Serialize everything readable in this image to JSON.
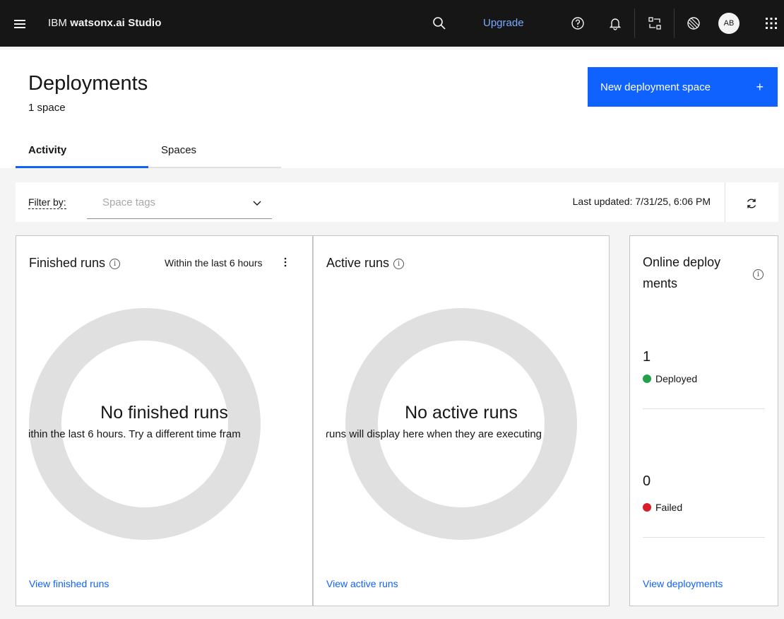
{
  "header": {
    "brand_prefix": "IBM",
    "brand_product": "watsonx.ai Studio",
    "upgrade_label": "Upgrade",
    "avatar_initials": "AB"
  },
  "page": {
    "title": "Deployments",
    "subtitle": "1 space",
    "new_button_label": "New deployment space",
    "new_button_icon": "+"
  },
  "tabs": [
    {
      "label": "Activity",
      "active": true
    },
    {
      "label": "Spaces",
      "active": false
    }
  ],
  "filter": {
    "label": "Filter by:",
    "placeholder": "Space tags",
    "last_updated": "Last updated: 7/31/25, 6:06 PM"
  },
  "cards": {
    "finished": {
      "title": "Finished runs",
      "range": "Within the last 6 hours",
      "empty_title": "No finished runs",
      "empty_sub": "ithin the last 6 hours. Try a different time fram",
      "link": "View finished runs"
    },
    "active": {
      "title": "Active runs",
      "empty_title": "No active runs",
      "empty_sub": "ɾuns will display here when they are executing",
      "link": "View active runs"
    },
    "online": {
      "title_line1": "Online deploy",
      "title_line2": "ments",
      "deployed_count": "1",
      "deployed_label": "Deployed",
      "failed_count": "0",
      "failed_label": "Failed",
      "link": "View deployments"
    }
  },
  "colors": {
    "accent": "#0f62fe",
    "success": "#24a148",
    "error": "#da1e28",
    "donut": "#e0e0e0"
  }
}
